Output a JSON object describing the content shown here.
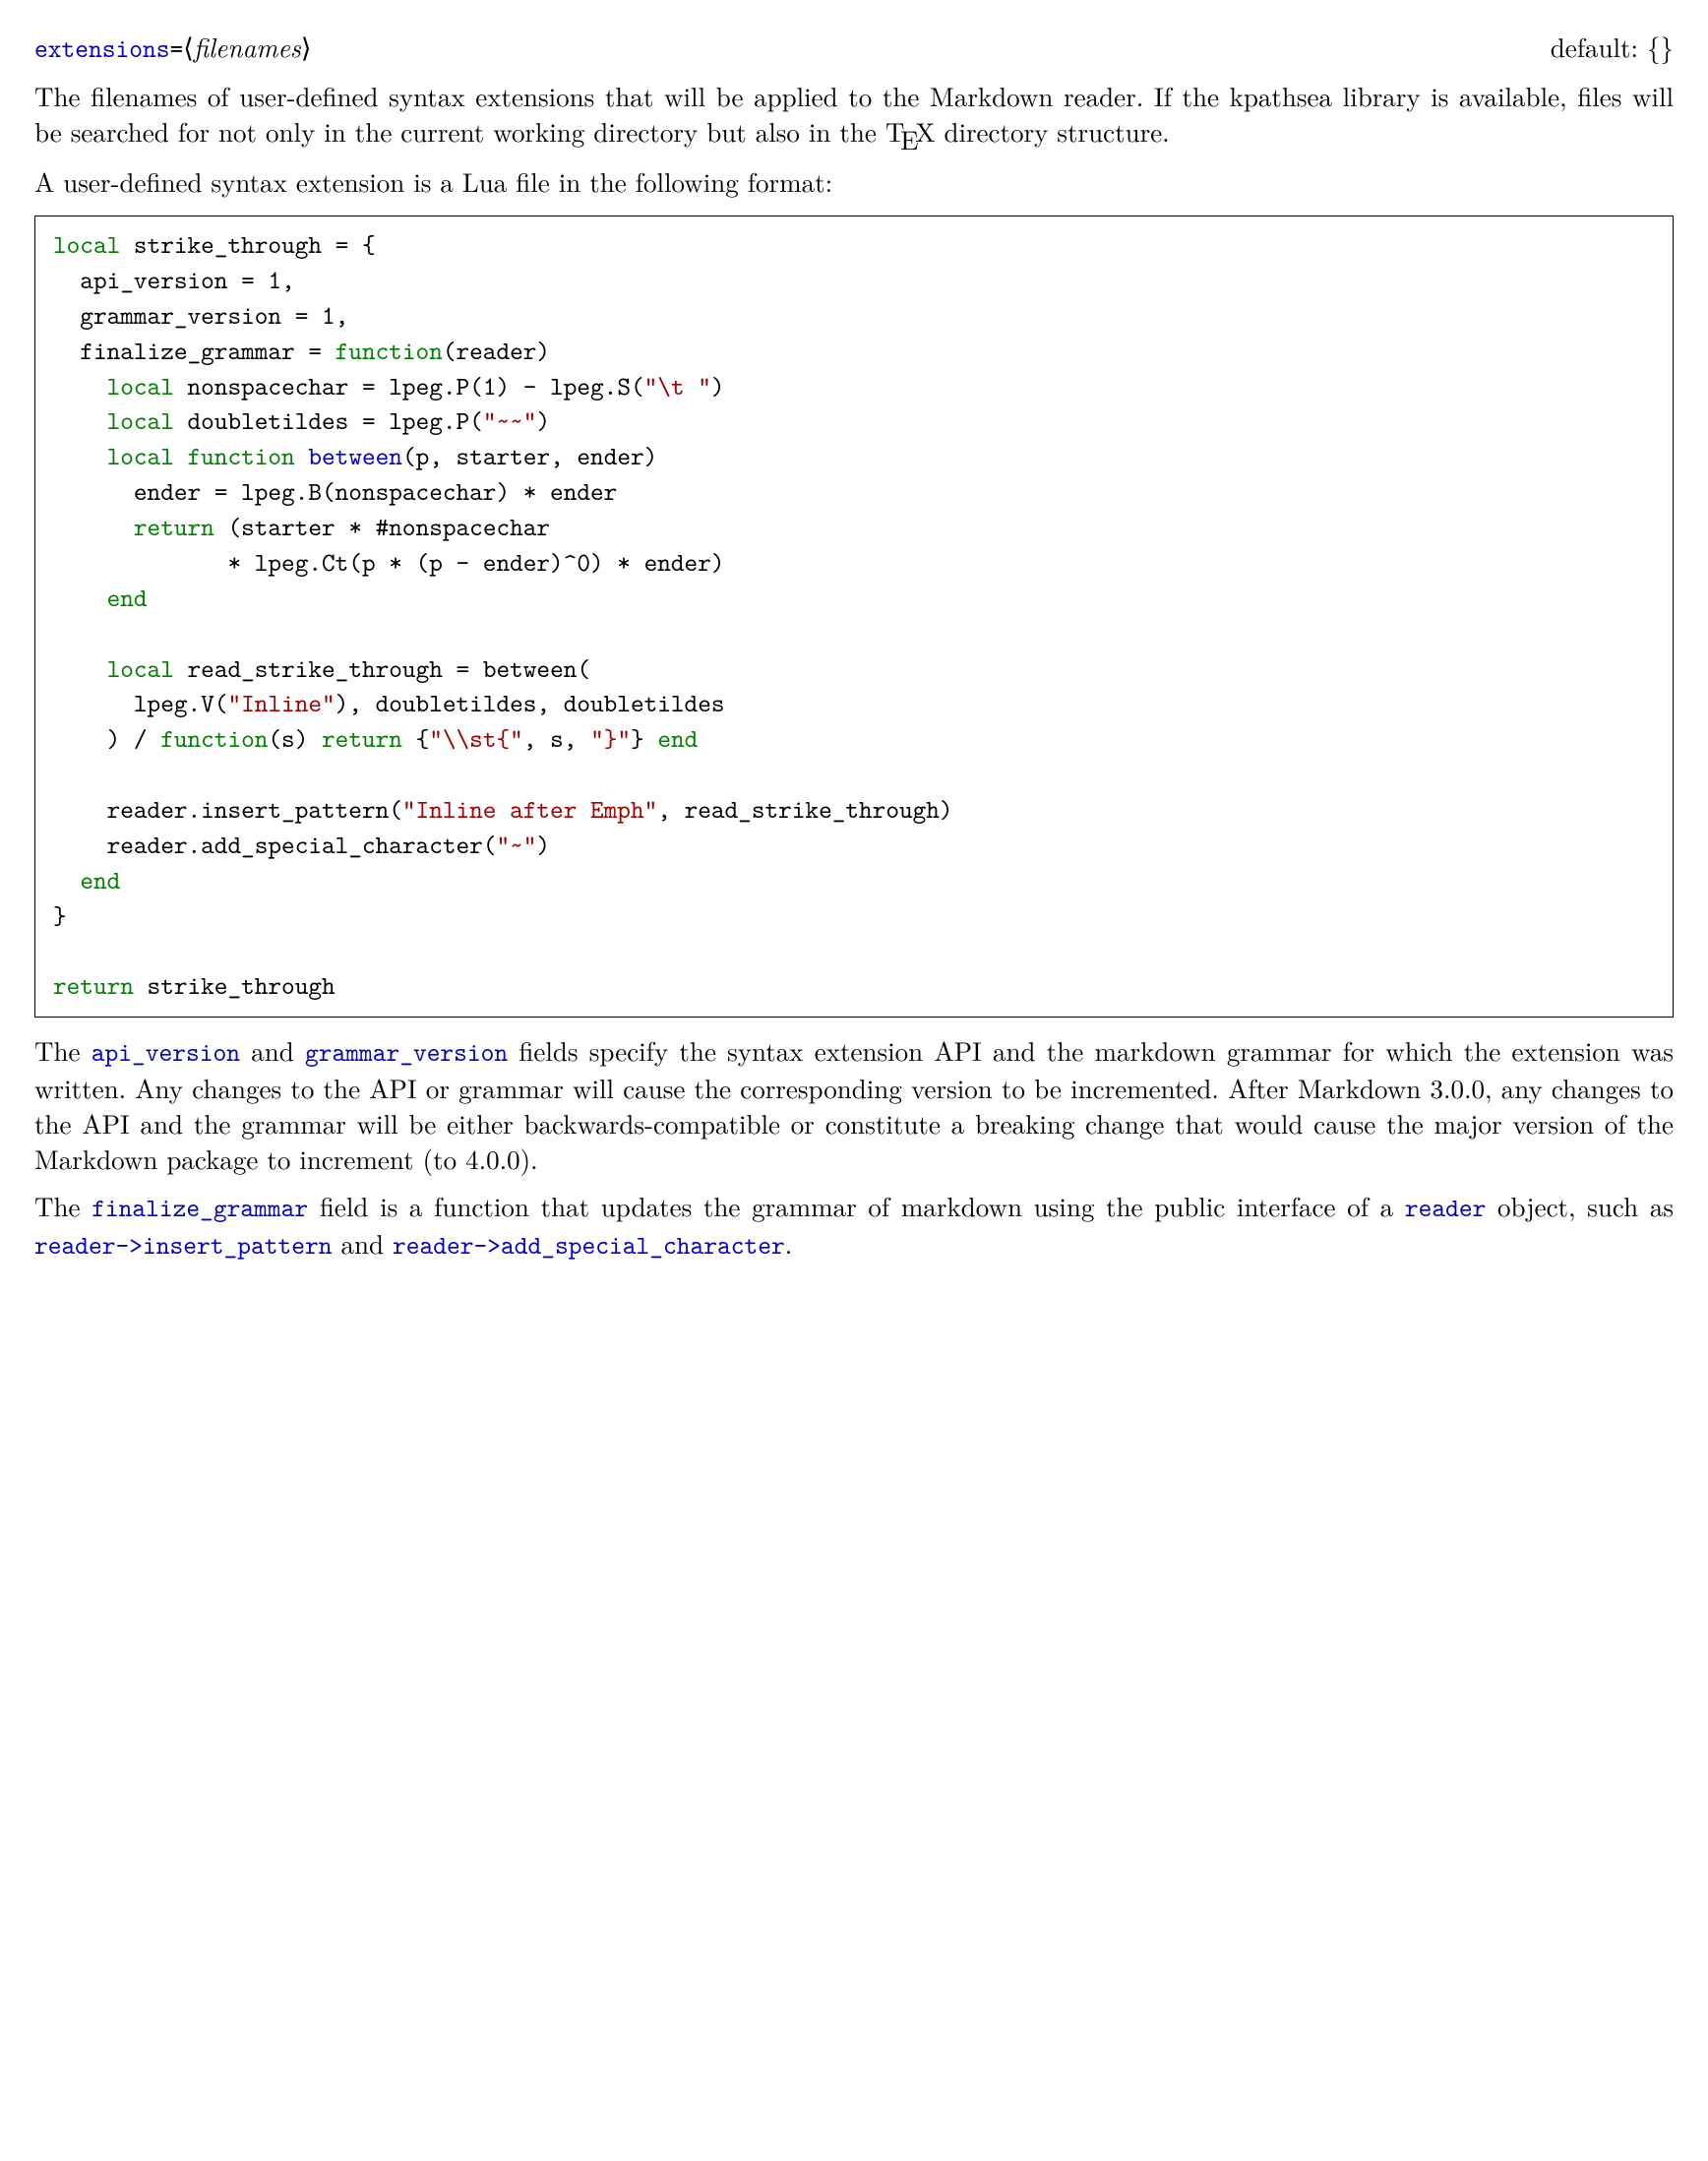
{
  "header": {
    "option_name": "extensions",
    "eq": "=",
    "lb": "⟨",
    "param": "filenames",
    "rb": "⟩",
    "default_label": "default: {}"
  },
  "para1_a": "The filenames of user-defined syntax extensions that will be applied to the Markdown reader. If the kpathsea library is available, files will be searched for not only in the current working directory but also in the ",
  "para1_b": " directory structure.",
  "tex_T": "T",
  "tex_E": "E",
  "tex_X": "X",
  "para2": "A user-defined syntax extension is a Lua file in the following format:",
  "code": {
    "l01a": "local",
    "l01b": " strike_through = {",
    "l02": "  api_version = 1,",
    "l03": "  grammar_version = 1,",
    "l04a": "  finalize_grammar = ",
    "l04b": "function",
    "l04c": "(reader)",
    "l05a": "    ",
    "l05b": "local",
    "l05c": " nonspacechar = lpeg.P(1) - lpeg.S(",
    "l05d": "\"\\t \"",
    "l05e": ")",
    "l06a": "    ",
    "l06b": "local",
    "l06c": " doubletildes = lpeg.P(",
    "l06d": "\"~~\"",
    "l06e": ")",
    "l07a": "    ",
    "l07b": "local function ",
    "l07c": "between",
    "l07d": "(p, starter, ender)",
    "l08": "      ender = lpeg.B(nonspacechar) * ender",
    "l09a": "      ",
    "l09b": "return",
    "l09c": " (starter * #nonspacechar",
    "l10": "             * lpeg.Ct(p * (p - ender)^0) * ender)",
    "l11a": "    ",
    "l11b": "end",
    "l12": "",
    "l13a": "    ",
    "l13b": "local",
    "l13c": " read_strike_through = between(",
    "l14a": "      lpeg.V(",
    "l14b": "\"Inline\"",
    "l14c": "), doubletildes, doubletildes",
    "l15a": "    ) / ",
    "l15b": "function",
    "l15c": "(s) ",
    "l15d": "return",
    "l15e": " {",
    "l15f": "\"\\\\st{\"",
    "l15g": ", s, ",
    "l15h": "\"}\"",
    "l15i": "} ",
    "l15j": "end",
    "l16": "",
    "l17a": "    reader.insert_pattern(",
    "l17b": "\"Inline after Emph\"",
    "l17c": ", read_strike_through)",
    "l18a": "    reader.add_special_character(",
    "l18b": "\"~\"",
    "l18c": ")",
    "l19a": "  ",
    "l19b": "end",
    "l20": "}",
    "l21": "",
    "l22a": "return",
    "l22b": " strike_through"
  },
  "para3_a": "The ",
  "para3_api": "api_version",
  "para3_b": " and ",
  "para3_gv": "grammar_version",
  "para3_c": " fields specify the syntax extension API and the markdown grammar for which the extension was written. Any changes to the API or grammar will cause the corresponding version to be incremented. After Markdown 3.0.0, any changes to the API and the grammar will be either backwards-compatible or constitute a breaking change that would cause the major version of the Markdown package to increment (to 4.0.0).",
  "para4_a": "The ",
  "para4_fg": "finalize_grammar",
  "para4_b": " field is a function that updates the grammar of markdown using the public interface of a ",
  "para4_reader": "reader",
  "para4_c": " object, such as ",
  "para4_ip": "reader->insert_pattern",
  "para4_d": " and ",
  "para4_asc": "reader->add_special_character",
  "para4_e": "."
}
